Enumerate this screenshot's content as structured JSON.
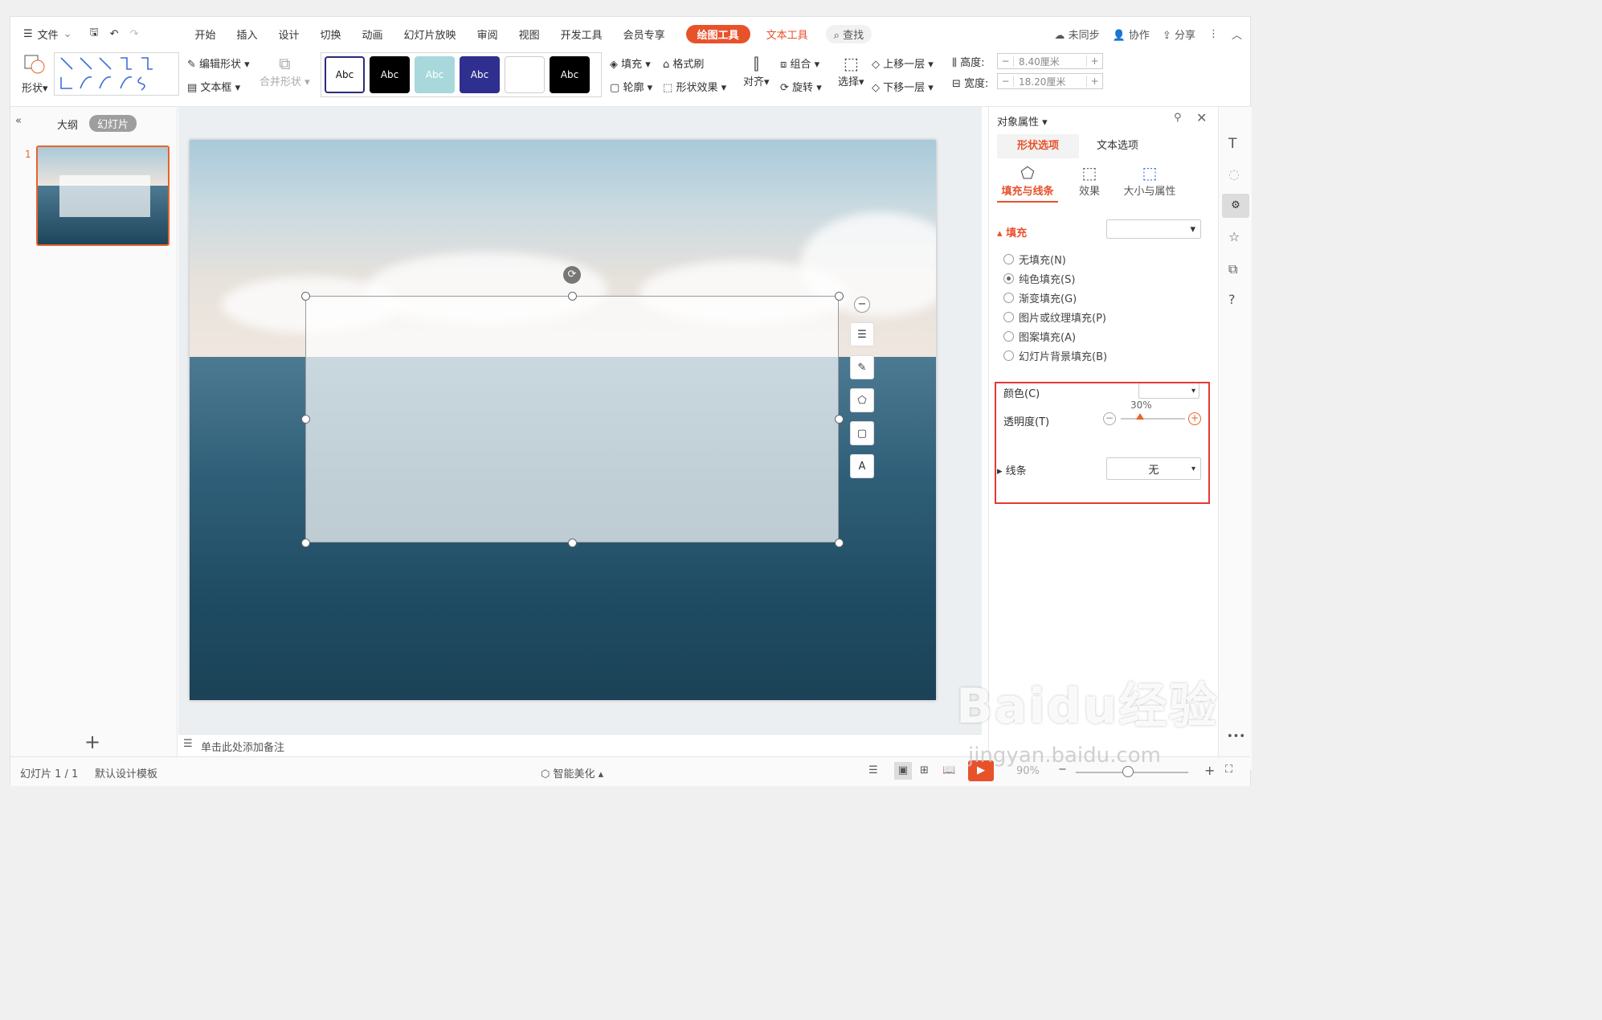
{
  "menubar": {
    "file": "文件",
    "items": [
      "开始",
      "插入",
      "设计",
      "切换",
      "动画",
      "幻灯片放映",
      "审阅",
      "视图",
      "开发工具",
      "会员专享"
    ],
    "drawing_tools": "绘图工具",
    "text_tools": "文本工具",
    "search": "查找",
    "unsynced": "未同步",
    "collab": "协作",
    "share": "分享"
  },
  "ribbon": {
    "shape": "形状",
    "edit_shape": "编辑形状",
    "text_box": "文本框",
    "merge_shape": "合并形状",
    "style_labels": [
      "Abc",
      "Abc",
      "Abc",
      "Abc",
      "",
      "Abc"
    ],
    "fill": "填充",
    "format_brush": "格式刷",
    "outline": "轮廓",
    "shape_effect": "形状效果",
    "align": "对齐",
    "group": "组合",
    "rotate": "旋转",
    "select": "选择",
    "bring_forward": "上移一层",
    "send_backward": "下移一层",
    "height_label": "高度:",
    "height_value": "8.40厘米",
    "width_label": "宽度:",
    "width_value": "18.20厘米",
    "minus": "−",
    "plus": "+"
  },
  "leftpane": {
    "outline_tab": "大纲",
    "slides_tab": "幻灯片",
    "slide_number": "1",
    "add": "+"
  },
  "notes": {
    "placeholder": "单击此处添加备注"
  },
  "panel": {
    "title": "对象属性",
    "tab_shape": "形状选项",
    "tab_text": "文本选项",
    "sub_fill_line": "填充与线条",
    "sub_effect": "效果",
    "sub_size": "大小与属性",
    "fill_section": "填充",
    "options": [
      "无填充(N)",
      "纯色填充(S)",
      "渐变填充(G)",
      "图片或纹理填充(P)",
      "图案填充(A)",
      "幻灯片背景填充(B)"
    ],
    "selected_index": 1,
    "color_label": "颜色(C)",
    "transparency_label": "透明度(T)",
    "transparency_value": "30%",
    "transparency_fraction": 0.3,
    "line_label": "线条",
    "line_value": "无"
  },
  "statusbar": {
    "slide_info": "幻灯片 1 / 1",
    "template": "默认设计模板",
    "smart_beautify": "智能美化",
    "zoom": "90%"
  },
  "watermark": {
    "brand": "Baidu经验",
    "url": "jingyan.baidu.com"
  },
  "colors": {
    "accent": "#e8522b",
    "highlight_box": "#e53935"
  }
}
